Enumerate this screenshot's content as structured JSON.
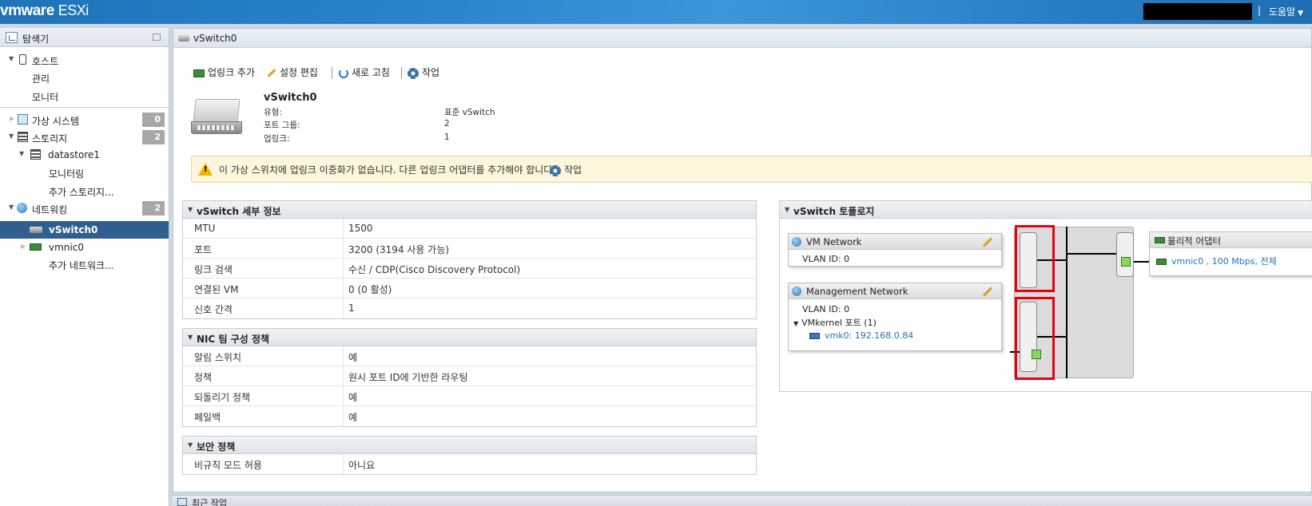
{
  "topbar": {
    "brand": "vmware",
    "product": "ESXi",
    "help": "도움말"
  },
  "navigator": {
    "title": "탐색기",
    "items": [
      {
        "label": "호스트"
      },
      {
        "label": "관리"
      },
      {
        "label": "모니터"
      },
      {
        "label": "가상 시스템",
        "badge": "0"
      },
      {
        "label": "스토리지",
        "badge": "2"
      },
      {
        "label": "datastore1"
      },
      {
        "label": "모니터링"
      },
      {
        "label": "추가 스토리지..."
      },
      {
        "label": "네트워킹",
        "badge": "2"
      },
      {
        "label": "vSwitch0"
      },
      {
        "label": "vmnic0"
      },
      {
        "label": "추가 네트워크..."
      }
    ]
  },
  "main": {
    "tab_title": "vSwitch0",
    "toolbar": {
      "add_uplink": "업링크 추가",
      "edit_settings": "설정 편집",
      "refresh": "새로 고침",
      "actions": "작업"
    },
    "summary": {
      "name": "vSwitch0",
      "rows": [
        {
          "key": "유형:",
          "value": "표준 vSwitch"
        },
        {
          "key": "포트 그룹:",
          "value": "2"
        },
        {
          "key": "업링크:",
          "value": "1"
        }
      ]
    },
    "warning": {
      "text": "이 가상 스위치에 업링크 이중화가 없습니다. 다른 업링크 어댑터를 추가해야 합니다.",
      "action": "작업"
    },
    "details": {
      "title": "vSwitch 세부 정보",
      "rows": [
        {
          "key": "MTU",
          "value": "1500"
        },
        {
          "key": "포트",
          "value": "3200 (3194 사용 가능)"
        },
        {
          "key": "링크 검색",
          "value": "수신 / CDP(Cisco Discovery Protocol)"
        },
        {
          "key": "연결된 VM",
          "value": "0 (0 활성)"
        },
        {
          "key": "신호 간격",
          "value": "1"
        }
      ]
    },
    "teaming": {
      "title": "NIC 팀 구성 정책",
      "rows": [
        {
          "key": "알림 스위치",
          "value": "예"
        },
        {
          "key": "정책",
          "value": "원시 포트 ID에 기반한 라우팅"
        },
        {
          "key": "되돌리기 정책",
          "value": "예"
        },
        {
          "key": "페일백",
          "value": "예"
        }
      ]
    },
    "security": {
      "title": "보안 정책",
      "rows": [
        {
          "key": "비규칙 모드 허용",
          "value": "아니요"
        }
      ]
    },
    "topology": {
      "title": "vSwitch 토폴로지",
      "vm_network": {
        "name": "VM Network",
        "vlan": "VLAN ID: 0"
      },
      "mgmt_network": {
        "name": "Management Network",
        "vlan": "VLAN ID: 0",
        "vmk_ports": "VMkernel 포트 (1)",
        "vmk0": "vmk0: 192.168.0.84"
      },
      "physical": {
        "title": "물리적 어댑터",
        "nic": "vmnic0 , 100 Mbps, 전체"
      }
    }
  },
  "bottom": {
    "label": "최근 작업"
  }
}
